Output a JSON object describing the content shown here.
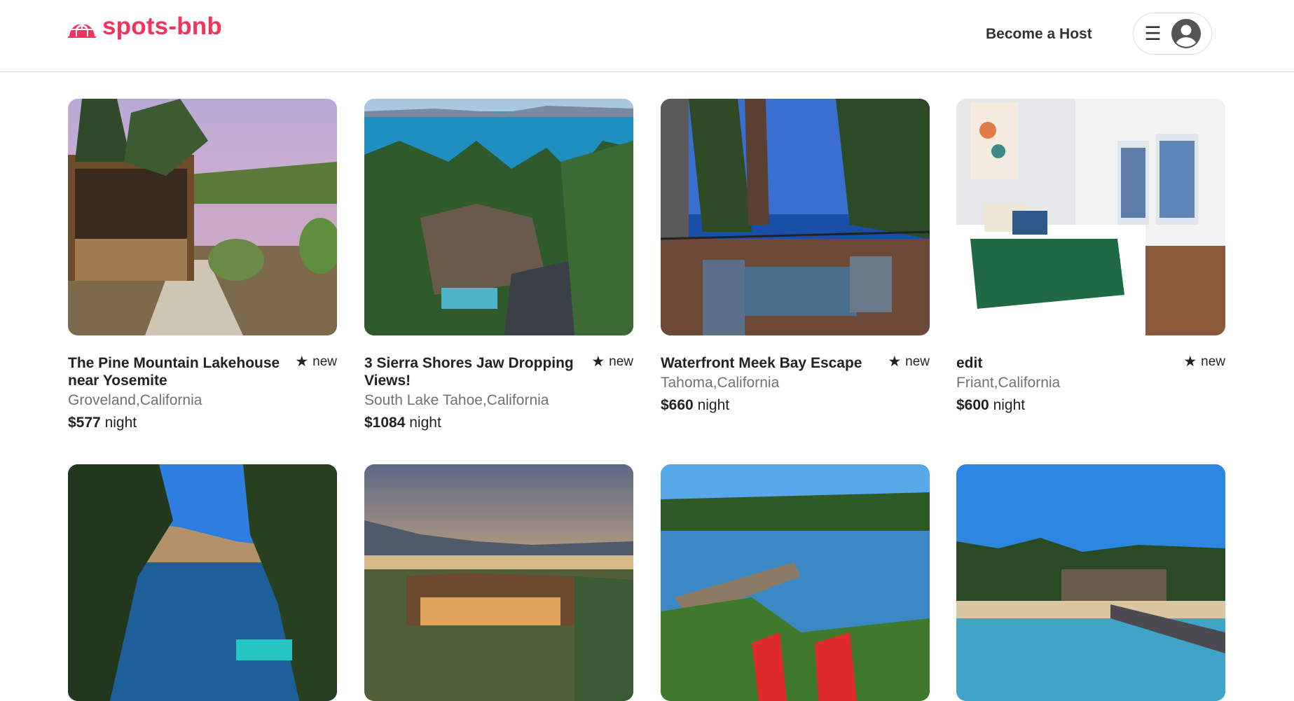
{
  "brand": {
    "name": "spots-bnb",
    "color": "#f0345d"
  },
  "header": {
    "become_host_label": "Become a Host",
    "menu_icon": "hamburger-menu-icon",
    "avatar_icon": "user-avatar-icon"
  },
  "price_unit": "night",
  "listings": [
    {
      "title": "The Pine Mountain Lakehouse near Yosemite",
      "rating": "new",
      "location": "Groveland,California",
      "price": "$577"
    },
    {
      "title": "3 Sierra Shores Jaw Dropping Views!",
      "rating": "new",
      "location": "South Lake Tahoe,California",
      "price": "$1084"
    },
    {
      "title": "Waterfront Meek Bay Escape",
      "rating": "new",
      "location": "Tahoma,California",
      "price": "$660"
    },
    {
      "title": "edit",
      "rating": "new",
      "location": "Friant,California",
      "price": "$600"
    },
    {
      "title": "",
      "rating": "",
      "location": "",
      "price": ""
    },
    {
      "title": "",
      "rating": "",
      "location": "",
      "price": ""
    },
    {
      "title": "",
      "rating": "",
      "location": "",
      "price": ""
    },
    {
      "title": "",
      "rating": "",
      "location": "",
      "price": ""
    }
  ]
}
